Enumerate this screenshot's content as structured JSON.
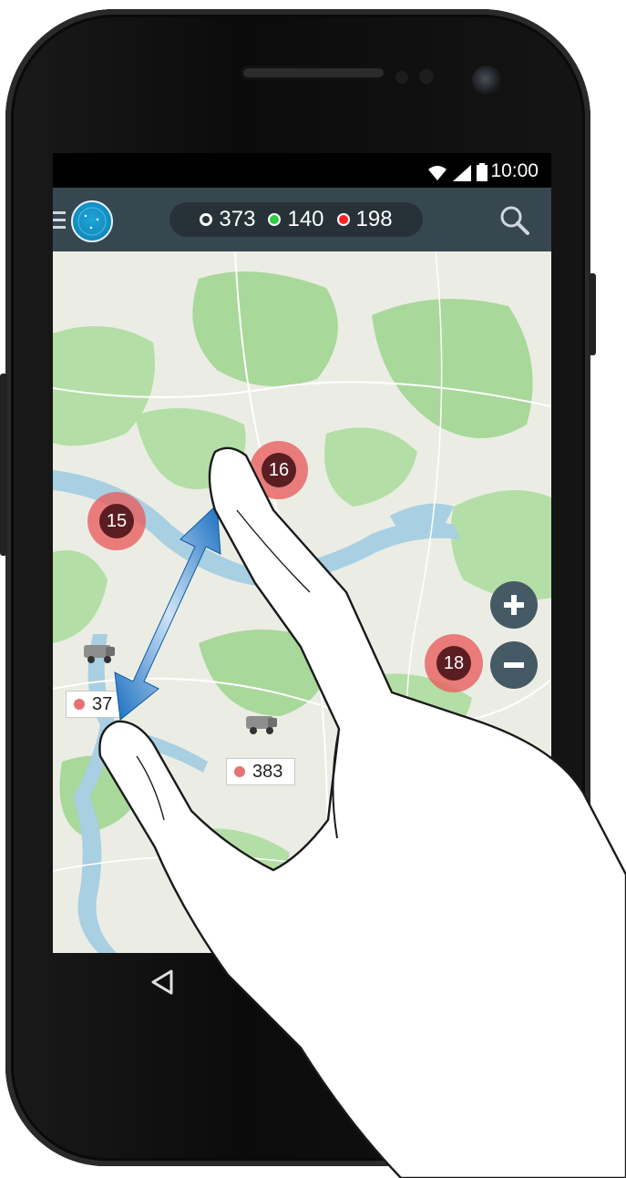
{
  "status_bar": {
    "time": "10:00"
  },
  "app_bar": {
    "counts": [
      {
        "value": "373",
        "color": "#ffffff",
        "style": "ring"
      },
      {
        "value": "140",
        "color": "#2ecc40",
        "style": "filled"
      },
      {
        "value": "198",
        "color": "#ff2020",
        "style": "filled"
      }
    ]
  },
  "map": {
    "clusters": [
      {
        "label": "16"
      },
      {
        "label": "15"
      },
      {
        "label": "18"
      }
    ],
    "vehicle_labels": [
      {
        "text": "37"
      },
      {
        "text": "383"
      }
    ]
  },
  "icons": {
    "menu": "menu-icon",
    "search": "search-icon",
    "zoom_in": "plus-icon",
    "zoom_out": "minus-icon",
    "back": "back-triangle-icon",
    "wifi": "wifi-icon",
    "signal": "signal-icon",
    "battery": "battery-icon"
  },
  "colors": {
    "appbar": "#37474f",
    "cluster": "#e85c5c",
    "cluster_core": "#5a1e22",
    "forest": "#a8d89a",
    "water": "#a8cfe2"
  }
}
